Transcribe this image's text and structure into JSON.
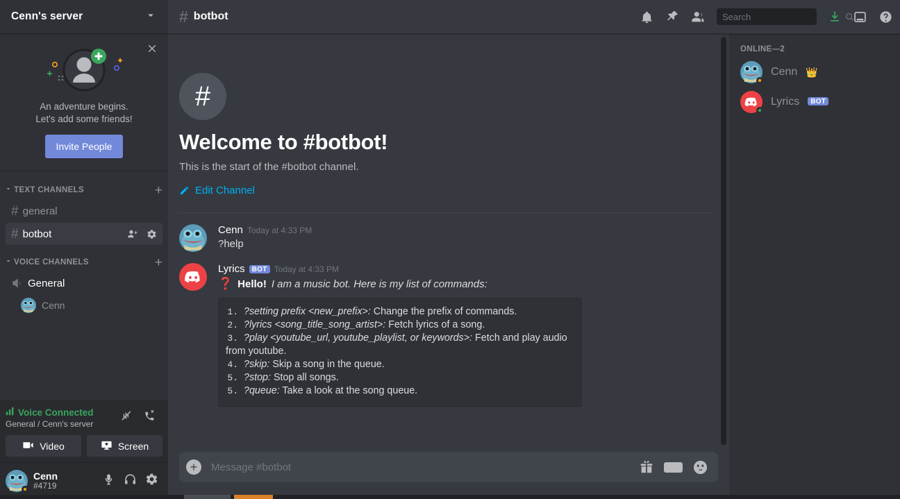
{
  "server": {
    "name": "Cenn's server",
    "chevron_icon": "chevron-down-icon"
  },
  "invite_card": {
    "line1": "An adventure begins.",
    "line2": "Let's add some friends!",
    "button_label": "Invite People",
    "close_icon": "close-icon",
    "accent_color": "#7289da"
  },
  "channel_categories": [
    {
      "label": "TEXT CHANNELS",
      "add_icon": "plus-icon",
      "channels": [
        {
          "name": "general",
          "type": "text",
          "active": false
        },
        {
          "name": "botbot",
          "type": "text",
          "active": true,
          "icons": [
            "add-member-icon",
            "gear-icon"
          ]
        }
      ]
    },
    {
      "label": "VOICE CHANNELS",
      "add_icon": "plus-icon",
      "channels": [
        {
          "name": "General",
          "type": "voice",
          "active": false,
          "members": [
            "Cenn"
          ]
        }
      ]
    }
  ],
  "voice_panel": {
    "status": "Voice Connected",
    "subtitle": "General / Cenn's server",
    "status_color": "#3ba55d",
    "noise_icon": "signal-slash-icon",
    "disconnect_icon": "phone-hangup-icon",
    "buttons": [
      {
        "label": "Video",
        "icon": "video-camera-icon"
      },
      {
        "label": "Screen",
        "icon": "screen-share-icon"
      }
    ]
  },
  "user_bar": {
    "name": "Cenn",
    "tag": "#4719",
    "icons": [
      "microphone-icon",
      "headphones-icon",
      "gear-icon"
    ],
    "status": "idle"
  },
  "topbar": {
    "hash_icon": "hash-icon",
    "channel_name": "botbot",
    "icons": [
      "bell-icon",
      "pin-icon",
      "members-icon"
    ],
    "right_icons": [
      "inbox-download-icon",
      "inbox-icon",
      "help-icon"
    ],
    "download_color": "#3ba55d"
  },
  "search": {
    "placeholder": "Search",
    "value": "",
    "icon": "search-icon"
  },
  "welcome": {
    "hash_icon": "hash-icon",
    "title": "Welcome to #botbot!",
    "subtitle": "This is the start of the #botbot channel.",
    "edit_label": "Edit Channel",
    "edit_icon": "pencil-icon",
    "edit_color": "#00aff4"
  },
  "messages": [
    {
      "author": "Cenn",
      "avatar": "pepe-avatar",
      "timestamp": "Today at 4:33 PM",
      "is_bot": false,
      "text": "?help"
    },
    {
      "author": "Lyrics",
      "avatar": "discord-logo-avatar",
      "timestamp": "Today at 4:33 PM",
      "is_bot": true,
      "bot_tag": "BOT",
      "hello_emoji": "question-mark-emoji",
      "hello_bold": "Hello!",
      "hello_italic": "I am a music bot. Here is my list of commands:",
      "commands": [
        {
          "num": "1.",
          "cmd": "?setting prefix <new_prefix>:",
          "desc": "Change the prefix of commands."
        },
        {
          "num": "2.",
          "cmd": "?lyrics <song_title_song_artist>:",
          "desc": "Fetch lyrics of a song."
        },
        {
          "num": "3.",
          "cmd": "?play <youtube_url, youtube_playlist, or keywords>:",
          "desc": "Fetch and play audio from youtube."
        },
        {
          "num": "4.",
          "cmd": "?skip:",
          "desc": "Skip a song in the queue."
        },
        {
          "num": "5.",
          "cmd": "?stop:",
          "desc": "Stop all songs."
        },
        {
          "num": "5.",
          "cmd": "?queue:",
          "desc": "Take a look at the song queue."
        }
      ]
    }
  ],
  "message_input": {
    "placeholder": "Message #botbot",
    "value": "",
    "plus_icon": "plus-circle-icon",
    "icons": [
      "gift-icon",
      "gif-icon",
      "emoji-icon"
    ],
    "gif_label": "GIF"
  },
  "member_list": {
    "category": "ONLINE—2",
    "members": [
      {
        "name": "Cenn",
        "avatar": "pepe-avatar",
        "status": "idle",
        "badge": "crown-icon"
      },
      {
        "name": "Lyrics",
        "avatar": "discord-logo-avatar",
        "status": "online",
        "badge": "BOT"
      }
    ]
  }
}
